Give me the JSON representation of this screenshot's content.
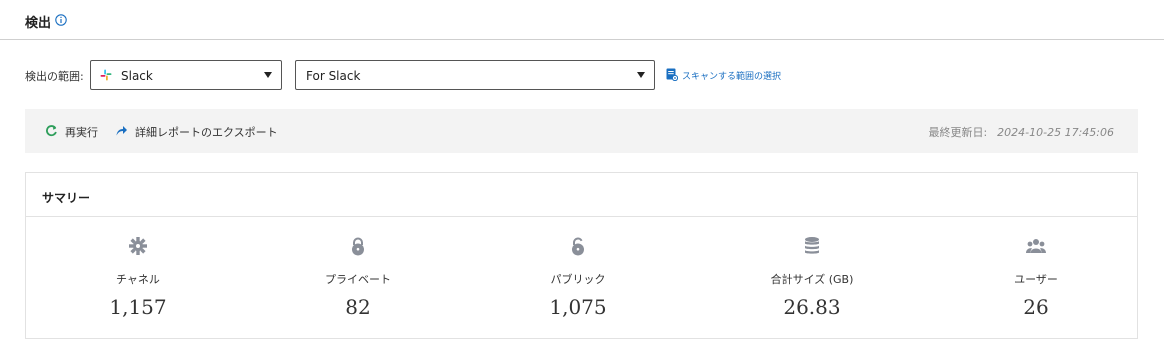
{
  "header": {
    "title": "検出",
    "info_icon": "info-circle-icon"
  },
  "scope": {
    "label": "検出の範囲:",
    "source_select": {
      "value": "Slack",
      "icon": "slack-icon"
    },
    "target_select": {
      "value": "For Slack"
    },
    "scan_link": "スキャンする範囲の選択"
  },
  "toolbar": {
    "rerun_label": "再実行",
    "export_label": "詳細レポートのエクスポート",
    "last_updated_label": "最終更新日:",
    "last_updated_value": "2024-10-25 17:45:06"
  },
  "summary": {
    "title": "サマリー",
    "stats": [
      {
        "label": "チャネル",
        "value": "1,157",
        "icon": "hashtag-icon"
      },
      {
        "label": "プライベート",
        "value": "82",
        "icon": "lock-closed-icon"
      },
      {
        "label": "パブリック",
        "value": "1,075",
        "icon": "lock-open-icon"
      },
      {
        "label": "合計サイズ (GB)",
        "value": "26.83",
        "icon": "database-icon"
      },
      {
        "label": "ユーザー",
        "value": "26",
        "icon": "users-icon"
      }
    ]
  },
  "colors": {
    "link": "#1a6fc1",
    "rerun_icon": "#2e9e5b",
    "export_icon": "#1a6fc1",
    "stat_icon": "#8a8f99",
    "toolbar_bg": "#f3f3f3"
  }
}
